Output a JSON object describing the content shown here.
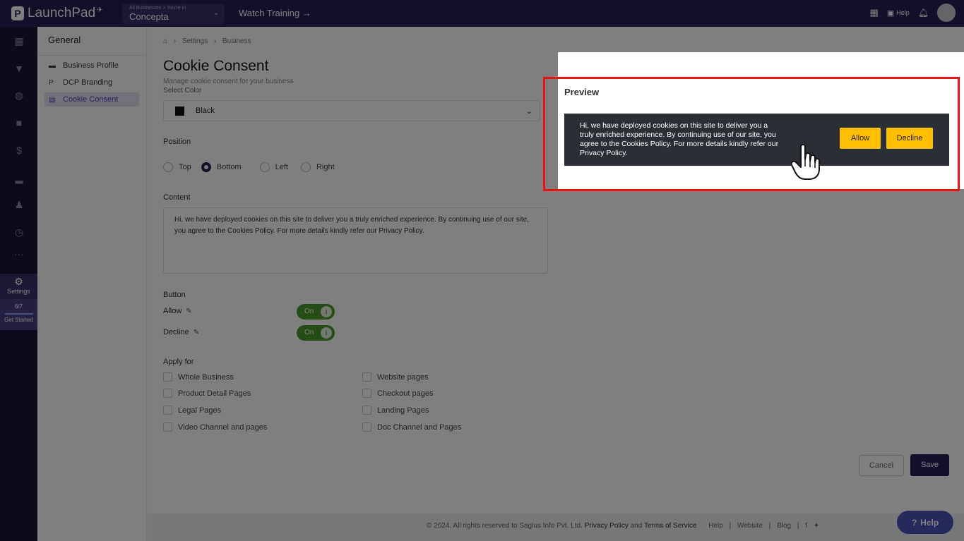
{
  "topbar": {
    "app_name": "LaunchPad",
    "business_switch_label": "All Businesses > You're in",
    "business_name": "Concepta",
    "watch_training": "Watch Training →",
    "help_label": "Help"
  },
  "rail": {
    "settings_label": "Settings",
    "progress_text": "6/7",
    "progress_fraction": 0.86,
    "get_started": "Get Started"
  },
  "subnav": {
    "title": "General",
    "items": [
      {
        "label": "Business Profile"
      },
      {
        "label": "DCP Branding"
      },
      {
        "label": "Cookie Consent"
      }
    ]
  },
  "main": {
    "breadcrumb": [
      "Settings",
      "Business"
    ],
    "title": "Cookie Consent",
    "subtitle": "Manage cookie consent for your business",
    "select_color_label": "Select Color",
    "selected_color": "Black",
    "selected_color_hex": "#111111",
    "position_label": "Position",
    "positions": [
      "Top",
      "Bottom",
      "Left",
      "Right"
    ],
    "selected_position": "Bottom",
    "content_label": "Content",
    "content_text": "Hi, we have deployed cookies on this site to deliver you a truly enriched experience. By continuing use of our site, you agree to the Cookies Policy. For more details kindly refer our Privacy Policy.",
    "button_label": "Button",
    "allow_label": "Allow",
    "decline_label": "Decline",
    "toggle_on": "On",
    "apply_for_label": "Apply for",
    "apply_left": [
      "Whole Business",
      "Product Detail Pages",
      "Legal Pages",
      "Video Channel and pages"
    ],
    "apply_right": [
      "Website pages",
      "Checkout pages",
      "Landing Pages",
      "Doc Channel and Pages"
    ],
    "cancel": "Cancel",
    "save": "Save"
  },
  "footer": {
    "copyright": "© 2024. All rights reserved to Saglus Info Pvt. Ltd.",
    "privacy": "Privacy Policy",
    "and": "and",
    "terms": "Terms of Service",
    "links": [
      "Help",
      "Website",
      "Blog"
    ]
  },
  "help_bubble": "Help",
  "preview": {
    "title": "Preview",
    "banner_text": "Hi, we have deployed cookies on this site to deliver you a truly enriched experience. By continuing use of our site, you agree to the Cookies Policy. For more details kindly refer our Privacy Policy.",
    "allow": "Allow",
    "decline": "Decline",
    "banner_bg": "#2b2f35",
    "button_color": "#ffbf00"
  }
}
